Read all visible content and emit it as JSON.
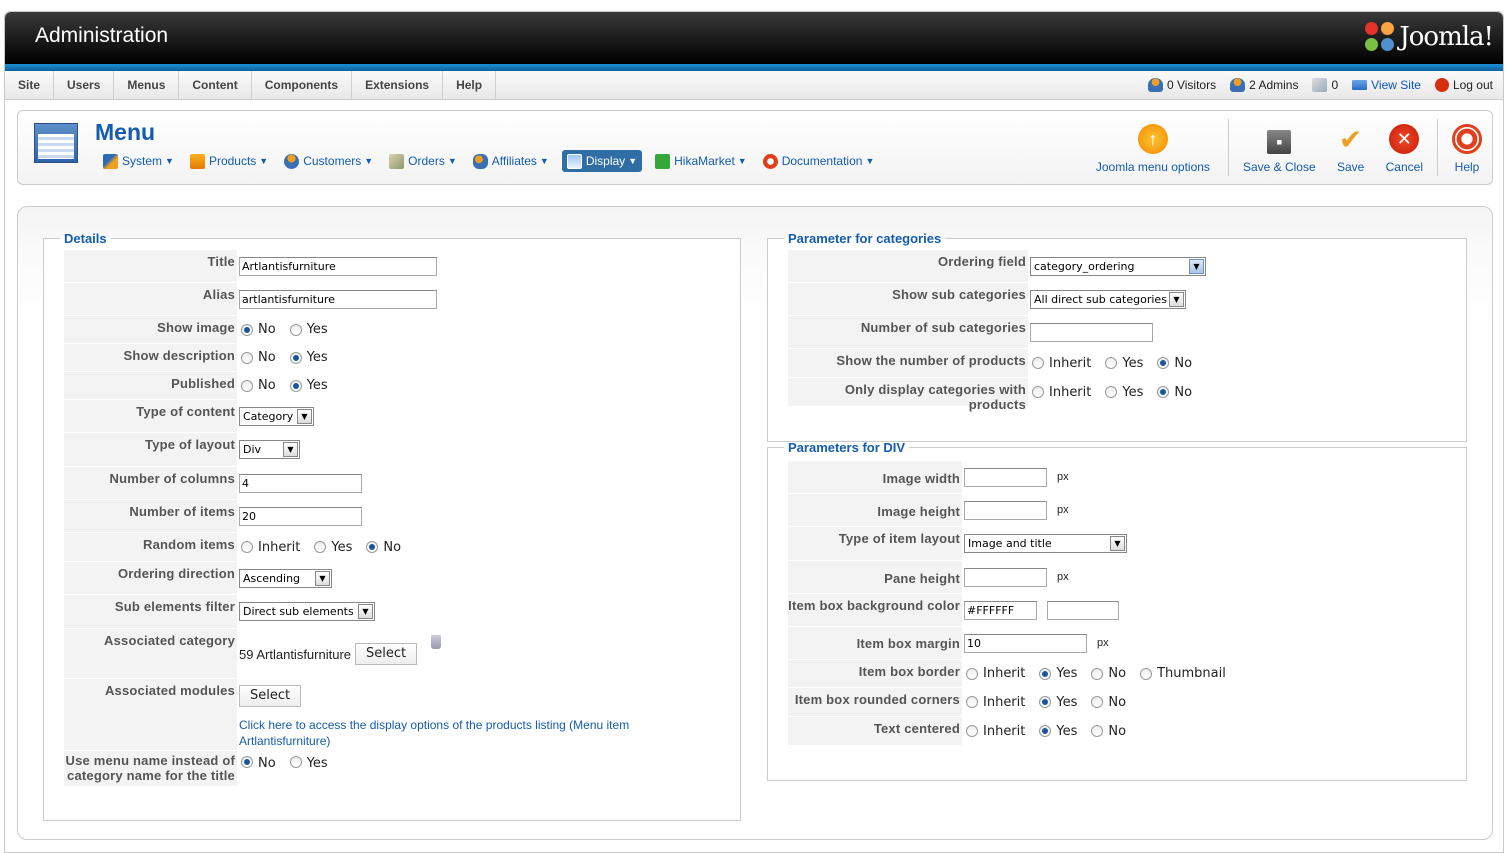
{
  "header": {
    "title": "Administration",
    "logo_text": "Joomla!"
  },
  "menubar": {
    "items": [
      "Site",
      "Users",
      "Menus",
      "Content",
      "Components",
      "Extensions",
      "Help"
    ],
    "status": {
      "visitors": "0 Visitors",
      "admins": "2 Admins",
      "messages": "0",
      "view_site": "View Site",
      "logout": "Log out"
    }
  },
  "toolbar": {
    "page_title": "Menu",
    "submenu": [
      {
        "label": "System",
        "icon": "wrench-icon"
      },
      {
        "label": "Products",
        "icon": "products-icon"
      },
      {
        "label": "Customers",
        "icon": "customers-icon"
      },
      {
        "label": "Orders",
        "icon": "orders-icon"
      },
      {
        "label": "Affiliates",
        "icon": "affiliates-icon"
      },
      {
        "label": "Display",
        "icon": "display-icon",
        "active": true
      },
      {
        "label": "HikaMarket",
        "icon": "hikamarket-icon"
      },
      {
        "label": "Documentation",
        "icon": "lifebuoy-icon"
      }
    ],
    "buttons": {
      "menu_options": "Joomla menu options",
      "save_close": "Save & Close",
      "save": "Save",
      "cancel": "Cancel",
      "help": "Help"
    }
  },
  "details": {
    "legend": "Details",
    "title_label": "Title",
    "title_value": "Artlantisfurniture",
    "alias_label": "Alias",
    "alias_value": "artlantisfurniture",
    "show_image_label": "Show image",
    "show_description_label": "Show description",
    "published_label": "Published",
    "no": "No",
    "yes": "Yes",
    "inherit": "Inherit",
    "type_content_label": "Type of content",
    "type_content_value": "Category",
    "type_layout_label": "Type of layout",
    "type_layout_value": "Div",
    "num_columns_label": "Number of columns",
    "num_columns_value": "4",
    "num_items_label": "Number of items",
    "num_items_value": "20",
    "random_items_label": "Random items",
    "ordering_direction_label": "Ordering direction",
    "ordering_direction_value": "Ascending",
    "sub_filter_label": "Sub elements filter",
    "sub_filter_value": "Direct sub elements",
    "assoc_category_label": "Associated category",
    "assoc_category_value": "59 Artlantisfurniture",
    "select": "Select",
    "assoc_modules_label": "Associated modules",
    "display_link": "Click here to access the display options of the products listing (Menu item Artlantisfurniture)",
    "use_menu_name_label": "Use menu name instead of category name for the title"
  },
  "categories": {
    "legend": "Parameter for categories",
    "ordering_field_label": "Ordering field",
    "ordering_field_value": "category_ordering",
    "show_sub_label": "Show sub categories",
    "show_sub_value": "All direct sub categories",
    "num_sub_label": "Number of sub categories",
    "num_sub_value": "",
    "show_num_products_label": "Show the number of products",
    "only_display_label": "Only display categories with products",
    "inherit": "Inherit",
    "yes": "Yes",
    "no": "No"
  },
  "div": {
    "legend": "Parameters for DIV",
    "image_width_label": "Image width",
    "image_height_label": "Image height",
    "item_layout_label": "Type of item layout",
    "item_layout_value": "Image and title",
    "pane_height_label": "Pane height",
    "bg_color_label": "Item box background color",
    "bg_color_value": "#FFFFFF",
    "margin_label": "Item box margin",
    "margin_value": "10",
    "border_label": "Item box border",
    "rounded_label": "Item box rounded corners",
    "centered_label": "Text centered",
    "px": "px",
    "inherit": "Inherit",
    "yes": "Yes",
    "no": "No",
    "thumbnail": "Thumbnail"
  }
}
